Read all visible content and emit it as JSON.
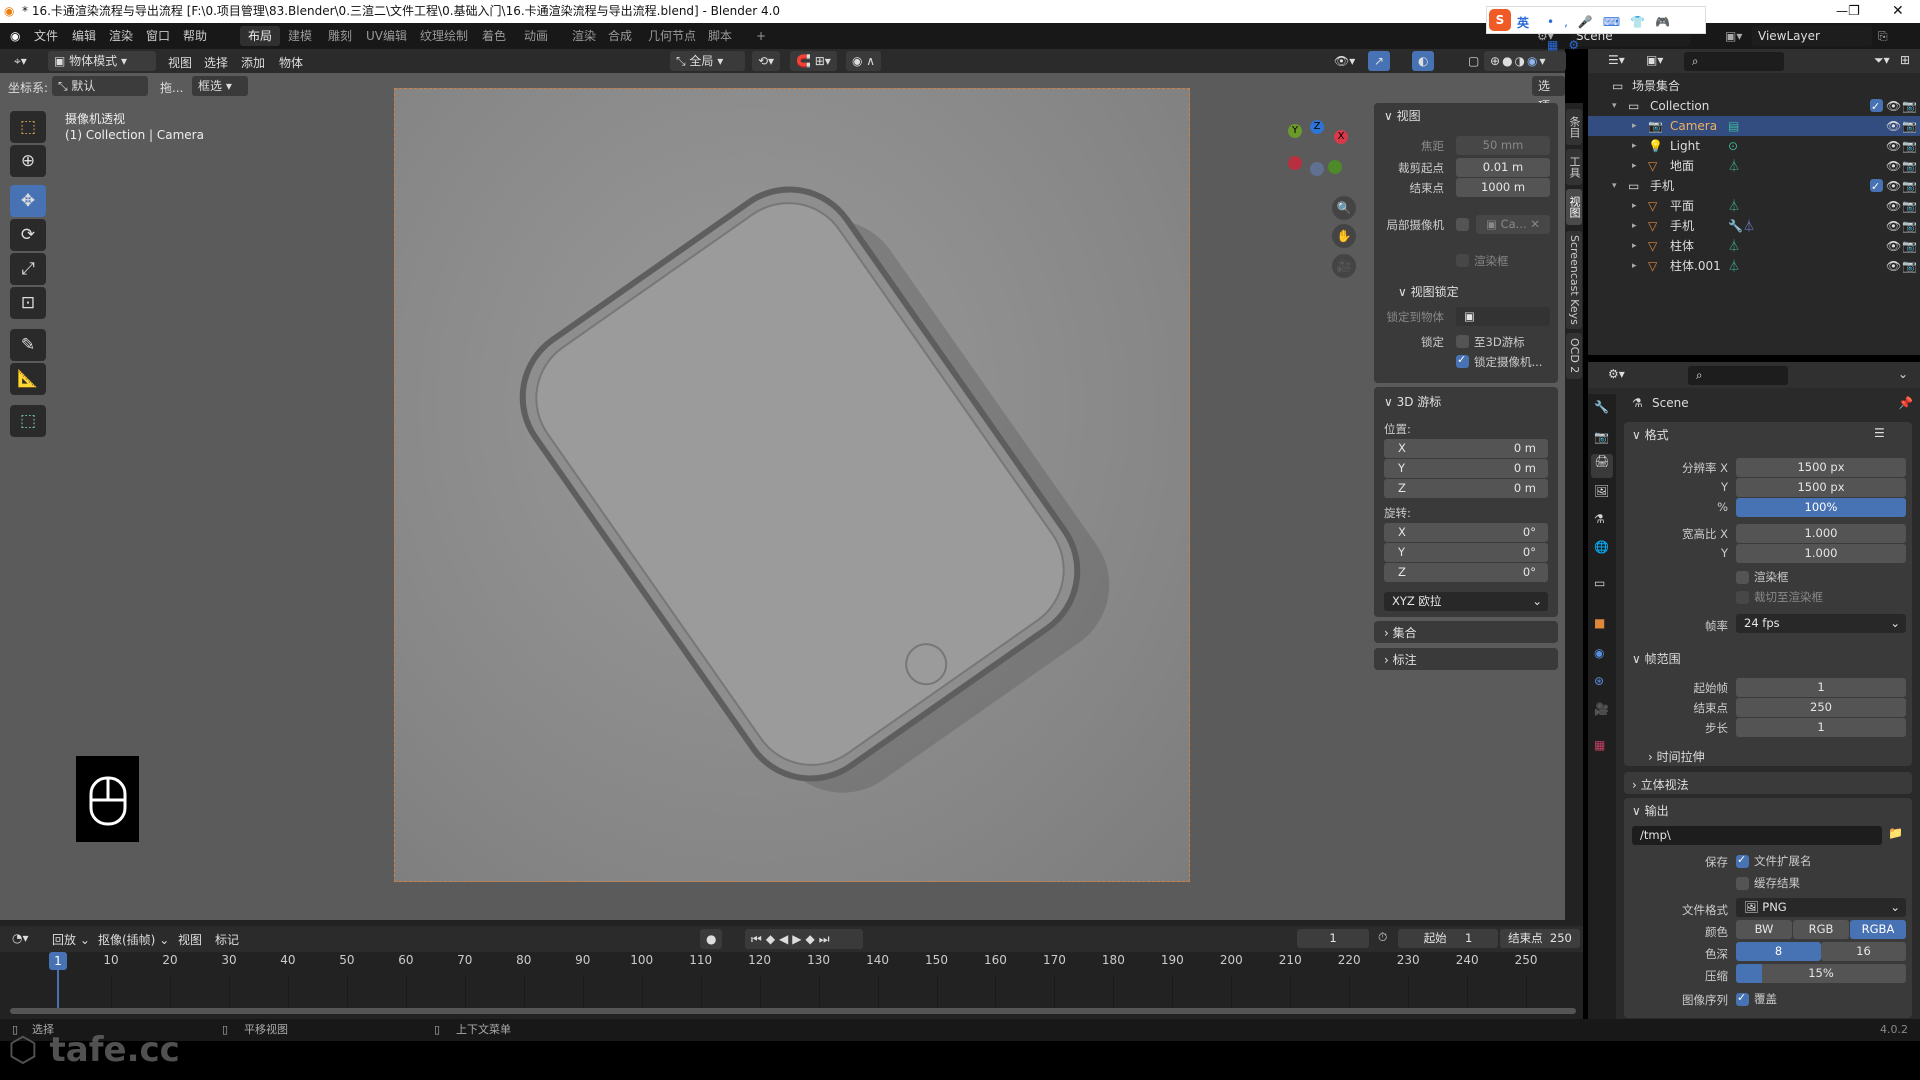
{
  "titlebar": {
    "title": "* 16.卡通渲染流程与导出流程 [F:\\0.项目管理\\83.Blender\\0.三渲二\\文件工程\\0.基础入门\\16.卡通渲染流程与导出流程.blend] - Blender 4.0"
  },
  "ime": {
    "lang": "英"
  },
  "menu": {
    "items": [
      "文件",
      "编辑",
      "渲染",
      "窗口",
      "帮助"
    ]
  },
  "workspaces": {
    "tabs": [
      "布局",
      "建模",
      "雕刻",
      "UV编辑",
      "纹理绘制",
      "着色",
      "动画",
      "渲染",
      "合成",
      "几何节点",
      "脚本"
    ],
    "active": "布局",
    "add": "+"
  },
  "scene": {
    "name": "Scene",
    "view_layer": "ViewLayer"
  },
  "viewport": {
    "mode": "物体模式",
    "menus": [
      "视图",
      "选择",
      "添加",
      "物体"
    ],
    "orientation": "全局",
    "coord_label": "坐标系:",
    "coord_value": "默认",
    "drag": "拖...",
    "select_mode": "框选",
    "options": "选项",
    "overlay_title": "摄像机透视",
    "overlay_sub": "(1) Collection | Camera",
    "gizmo": {
      "x": "X",
      "y": "Y",
      "z": "Z"
    }
  },
  "npanel": {
    "tabs": [
      "条目",
      "工具",
      "视图",
      "Screencast Keys",
      "OCD 2"
    ],
    "view": {
      "title": "视图",
      "focal_label": "焦距",
      "focal": "50 mm",
      "clip_start_label": "裁剪起点",
      "clip_start": "0.01 m",
      "clip_end_label": "结束点",
      "clip_end": "1000 m",
      "local_camera_label": "局部摄像机",
      "local_camera": "Ca...",
      "render_region": "渲染框",
      "lock_title": "视图锁定",
      "lock_object_label": "锁定到物体",
      "lock_label": "锁定",
      "to_cursor": "至3D游标",
      "lock_camera": "锁定摄像机..."
    },
    "cursor": {
      "title": "3D 游标",
      "location_label": "位置:",
      "location": [
        {
          "axis": "X",
          "value": "0 m"
        },
        {
          "axis": "Y",
          "value": "0 m"
        },
        {
          "axis": "Z",
          "value": "0 m"
        }
      ],
      "rotation_label": "旋转:",
      "rotation": [
        {
          "axis": "X",
          "value": "0°"
        },
        {
          "axis": "Y",
          "value": "0°"
        },
        {
          "axis": "Z",
          "value": "0°"
        }
      ],
      "mode": "XYZ 欧拉"
    },
    "collection": "集合",
    "annotation": "标注"
  },
  "outliner": {
    "root": "场景集合",
    "rows": [
      {
        "name": "Collection",
        "type": "collection",
        "depth": 0,
        "checked": true
      },
      {
        "name": "Camera",
        "type": "camera",
        "depth": 1,
        "selected": true
      },
      {
        "name": "Light",
        "type": "light",
        "depth": 1
      },
      {
        "name": "地面",
        "type": "mesh",
        "depth": 1
      },
      {
        "name": "手机",
        "type": "collection",
        "depth": 0,
        "checked": true
      },
      {
        "name": "平面",
        "type": "mesh",
        "depth": 1
      },
      {
        "name": "手机",
        "type": "mesh-mod",
        "depth": 1
      },
      {
        "name": "柱体",
        "type": "mesh",
        "depth": 1
      },
      {
        "name": "柱体.001",
        "type": "mesh",
        "depth": 1
      }
    ]
  },
  "properties": {
    "context": "Scene",
    "format": {
      "title": "格式",
      "res_x_label": "分辨率 X",
      "res_x": "1500 px",
      "res_y_label": "Y",
      "res_y": "1500 px",
      "pct_label": "%",
      "pct": "100%",
      "aspect_x_label": "宽高比 X",
      "aspect_x": "1.000",
      "aspect_y_label": "Y",
      "aspect_y": "1.000",
      "render_region": "渲染框",
      "crop": "裁切至渲染框",
      "fps_label": "帧率",
      "fps": "24 fps"
    },
    "frame_range": {
      "title": "帧范围",
      "start_label": "起始帧",
      "start": "1",
      "end_label": "结束点",
      "end": "250",
      "step_label": "步长",
      "step": "1",
      "time_stretch": "时间拉伸"
    },
    "stereoscopy": "立体视法",
    "output": {
      "title": "输出",
      "path": "/tmp\\",
      "save_label": "保存",
      "file_ext": "文件扩展名",
      "cache": "缓存结果",
      "format_label": "文件格式",
      "format": "PNG",
      "color_label": "颜色",
      "color_options": [
        "BW",
        "RGB",
        "RGBA"
      ],
      "color_selected": "RGBA",
      "depth_label": "色深",
      "depth_options": [
        "8",
        "16"
      ],
      "depth_selected": "8",
      "compression_label": "压缩",
      "compression": "15%",
      "compression_value": 15,
      "sequence_label": "图像序列",
      "overwrite": "覆盖"
    }
  },
  "timeline": {
    "menus": [
      "回放",
      "抠像(插帧)",
      "视图",
      "标记"
    ],
    "current_frame": "1",
    "start_label": "起始",
    "start": "1",
    "end_label": "结束点",
    "end": "250",
    "ticks": [
      "10",
      "20",
      "30",
      "40",
      "50",
      "60",
      "70",
      "80",
      "90",
      "100",
      "110",
      "120",
      "130",
      "140",
      "150",
      "160",
      "170",
      "180",
      "190",
      "200",
      "210",
      "220",
      "230",
      "240",
      "250"
    ]
  },
  "statusbar": {
    "select": "选择",
    "pan": "平移视图",
    "context_menu": "上下文菜单",
    "version": "4.0.2"
  },
  "watermark": "tafe.cc",
  "colors": {
    "accent": "#4772b3",
    "selected_row": "#334d80",
    "object_orange": "#e0883a",
    "mesh_data_green": "#3cb89a"
  }
}
